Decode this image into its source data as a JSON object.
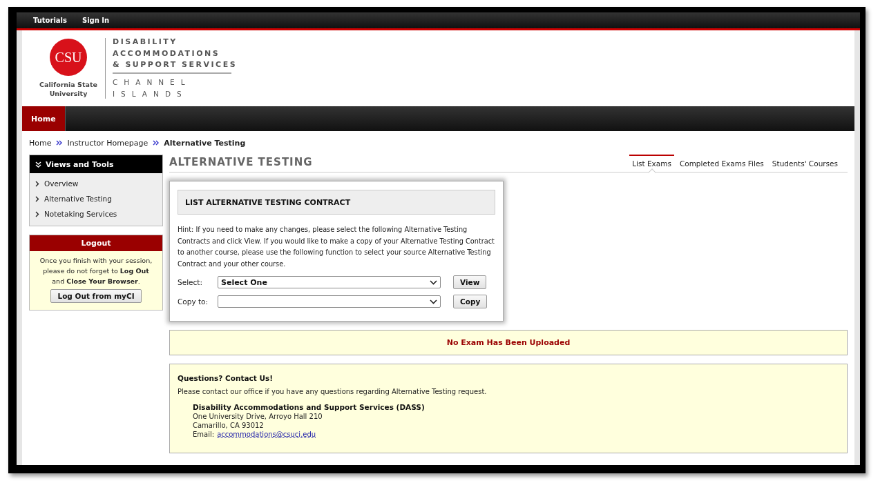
{
  "top_links": [
    "Tutorials",
    "Sign In"
  ],
  "logo": {
    "mark": "CSU",
    "university": [
      "California State",
      "University"
    ],
    "department": [
      "DISABILITY",
      "ACCOMMODATIONS",
      "& SUPPORT SERVICES"
    ],
    "campus": [
      "CHANNEL",
      "ISLANDS"
    ]
  },
  "nav": [
    {
      "label": "Home",
      "selected": true
    }
  ],
  "breadcrumbs": [
    {
      "label": "Home",
      "current": false
    },
    {
      "label": "Instructor Homepage",
      "current": false
    },
    {
      "label": "Alternative Testing",
      "current": true
    }
  ],
  "sidebar": {
    "title": "Views and Tools",
    "items": [
      "Overview",
      "Alternative Testing",
      "Notetaking Services"
    ]
  },
  "logout": {
    "title": "Logout",
    "message": "Once you finish with your session, please do not forget to **Log Out** and **Close Your Browser**.",
    "button": "Log Out from myCI"
  },
  "page_title": "ALTERNATIVE TESTING",
  "tabs": [
    {
      "label": "List Exams",
      "selected": true
    },
    {
      "label": "Completed Exams Files",
      "selected": false
    },
    {
      "label": "Students' Courses",
      "selected": false
    }
  ],
  "contract": {
    "title": "LIST ALTERNATIVE TESTING CONTRACT",
    "hint": "Hint: If you need to make any changes, please select the following Alternative Testing Contracts and click View. If you would like to make a copy of your Alternative Testing Contract to another course, please use the following function to select your source Alternative Testing Contract and your other course.",
    "rows": [
      {
        "label": "Select:",
        "value": "Select One",
        "button": "View"
      },
      {
        "label": "Copy to:",
        "value": "",
        "button": "Copy"
      }
    ]
  },
  "notice": "No Exam Has Been Uploaded",
  "contact": {
    "title": "Questions? Contact Us!",
    "text": "Please contact our office if you have any questions regarding Alternative Testing request.",
    "office": "Disability Accommodations and Support Services (DASS)",
    "address": [
      "One University Drive, Arroyo Hall 210",
      "Camarillo, CA 93012"
    ],
    "email_label": "Email:",
    "email": "accommodations@csuci.edu"
  }
}
